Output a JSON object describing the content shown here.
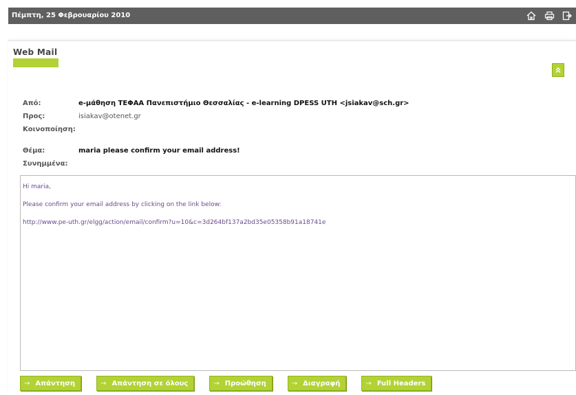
{
  "topbar": {
    "date": "Πέμπτη, 25 Φεβρουαρίου 2010",
    "icons": [
      "home-icon",
      "print-icon",
      "logout-icon"
    ]
  },
  "panel": {
    "title": "Web Mail",
    "collapse_icon": "chevron-up-icon",
    "accent_color": "#b2d235"
  },
  "headers": {
    "from_label": "Από:",
    "from_value": "e-μάθηση ΤΕΦΑΑ Πανεπιστήμιο Θεσσαλίας - e-learning DPESS UTH <jsiakav@sch.gr>",
    "to_label": "Προς:",
    "to_value": "isiakav@otenet.gr",
    "cc_label": "Κοινοποίηση:",
    "subject_label": "Θέμα:",
    "subject_value": "maria please confirm your email address!",
    "attachments_label": "Συνημμένα:"
  },
  "body": {
    "lines": [
      "Hi maria,",
      "Please confirm your email address by clicking on the link below:",
      "http://www.pe-uth.gr/elgg/action/email/confirm?u=10&c=3d264bf137a2bd35e05358b91a18741e"
    ]
  },
  "actions": {
    "reply": "Απάντηση",
    "reply_all": "Απάντηση σε όλους",
    "forward": "Προώθηση",
    "delete": "Διαγραφή",
    "full_headers": "Full Headers",
    "arrow_glyph": "→"
  }
}
